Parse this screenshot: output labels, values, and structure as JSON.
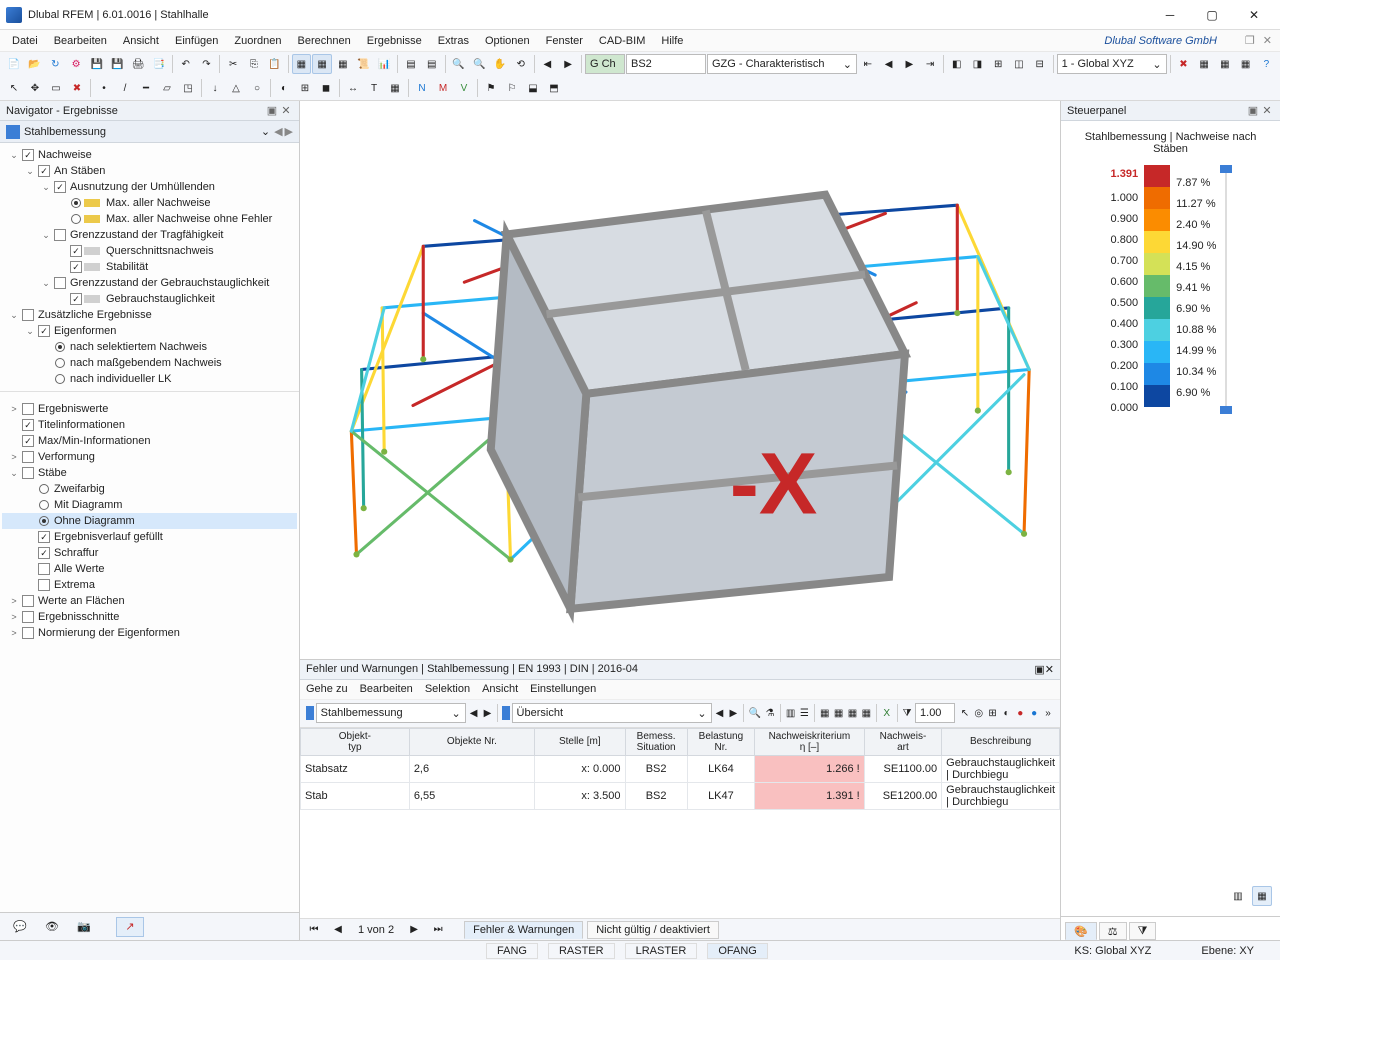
{
  "app": {
    "title": "Dlubal RFEM | 6.01.0016 | Stahlhalle",
    "vendor": "Dlubal Software GmbH"
  },
  "menu": [
    "Datei",
    "Bearbeiten",
    "Ansicht",
    "Einfügen",
    "Zuordnen",
    "Berechnen",
    "Ergebnisse",
    "Extras",
    "Optionen",
    "Fenster",
    "CAD-BIM",
    "Hilfe"
  ],
  "toolbar2": {
    "gch_btn": "G Ch",
    "field1": "BS2",
    "combo": "GZG - Charakteristisch",
    "coord_combo": "1 - Global XYZ"
  },
  "navigator": {
    "title": "Navigator - Ergebnisse",
    "section": "Stahlbemessung",
    "tree1": [
      {
        "lvl": 0,
        "tw": "⌄",
        "cb": true,
        "label": "Nachweise"
      },
      {
        "lvl": 1,
        "tw": "⌄",
        "cb": true,
        "label": "An Stäben"
      },
      {
        "lvl": 2,
        "tw": "⌄",
        "cb": true,
        "label": "Ausnutzung der Umhüllenden"
      },
      {
        "lvl": 3,
        "rb": true,
        "label": "Max. aller Nachweise",
        "sw": "#ecc94a"
      },
      {
        "lvl": 3,
        "rb": false,
        "label": "Max. aller Nachweise ohne Fehler",
        "sw": "#ecc94a"
      },
      {
        "lvl": 2,
        "tw": "⌄",
        "cb": false,
        "label": "Grenzzustand der Tragfähigkeit"
      },
      {
        "lvl": 3,
        "cb": true,
        "label": "Querschnittsnachweis",
        "sw": "#d0d0d0"
      },
      {
        "lvl": 3,
        "cb": true,
        "label": "Stabilität",
        "sw": "#d0d0d0"
      },
      {
        "lvl": 2,
        "tw": "⌄",
        "cb": false,
        "label": "Grenzzustand der Gebrauchstauglichkeit"
      },
      {
        "lvl": 3,
        "cb": true,
        "label": "Gebrauchstauglichkeit",
        "sw": "#d0d0d0"
      },
      {
        "lvl": 0,
        "tw": "⌄",
        "cb": false,
        "label": "Zusätzliche Ergebnisse"
      },
      {
        "lvl": 1,
        "tw": "⌄",
        "cb": true,
        "label": "Eigenformen"
      },
      {
        "lvl": 2,
        "rb": true,
        "label": "nach selektiertem Nachweis"
      },
      {
        "lvl": 2,
        "rb": false,
        "label": "nach maßgebendem Nachweis"
      },
      {
        "lvl": 2,
        "rb": false,
        "label": "nach individueller LK"
      }
    ],
    "tree2": [
      {
        "lvl": 0,
        "tw": ">",
        "cb": false,
        "label": "Ergebniswerte"
      },
      {
        "lvl": 0,
        "cb": true,
        "label": "Titelinformationen"
      },
      {
        "lvl": 0,
        "cb": true,
        "label": "Max/Min-Informationen"
      },
      {
        "lvl": 0,
        "tw": ">",
        "cb": false,
        "label": "Verformung"
      },
      {
        "lvl": 0,
        "tw": "⌄",
        "cb": false,
        "label": "Stäbe"
      },
      {
        "lvl": 1,
        "rb": false,
        "label": "Zweifarbig"
      },
      {
        "lvl": 1,
        "rb": false,
        "label": "Mit Diagramm"
      },
      {
        "lvl": 1,
        "rb": true,
        "label": "Ohne Diagramm",
        "sel": true
      },
      {
        "lvl": 1,
        "cb": true,
        "label": "Ergebnisverlauf gefüllt"
      },
      {
        "lvl": 1,
        "cb": true,
        "label": "Schraffur"
      },
      {
        "lvl": 1,
        "cb": false,
        "label": "Alle Werte"
      },
      {
        "lvl": 1,
        "cb": false,
        "label": "Extrema"
      },
      {
        "lvl": 0,
        "tw": ">",
        "cb": false,
        "label": "Werte an Flächen"
      },
      {
        "lvl": 0,
        "tw": ">",
        "cb": false,
        "label": "Ergebnisschnitte"
      },
      {
        "lvl": 0,
        "tw": ">",
        "cb": false,
        "label": "Normierung der Eigenformen"
      }
    ]
  },
  "steuerpanel": {
    "title": "Steuerpanel",
    "subtitle": "Stahlbemessung | Nachweise nach Stäben",
    "max": "1.391",
    "scale": [
      "1.000",
      "0.900",
      "0.800",
      "0.700",
      "0.600",
      "0.500",
      "0.400",
      "0.300",
      "0.200",
      "0.100",
      "0.000"
    ],
    "colors": [
      "#c62828",
      "#ef6c00",
      "#fb8c00",
      "#fdd835",
      "#d4e157",
      "#66bb6a",
      "#26a69a",
      "#4dd0e1",
      "#29b6f6",
      "#1e88e5",
      "#0d47a1"
    ],
    "pct": [
      "7.87 %",
      "11.27 %",
      "2.40 %",
      "14.90 %",
      "4.15 %",
      "9.41 %",
      "6.90 %",
      "10.88 %",
      "14.99 %",
      "10.34 %",
      "6.90 %"
    ]
  },
  "bottom": {
    "title": "Fehler und Warnungen | Stahlbemessung | EN 1993 | DIN | 2016-04",
    "menu": [
      "Gehe zu",
      "Bearbeiten",
      "Selektion",
      "Ansicht",
      "Einstellungen"
    ],
    "combo1": "Stahlbemessung",
    "combo2": "Übersicht",
    "headers": [
      "Objekt-\ntyp",
      "Objekte Nr.",
      "Stelle [m]",
      "Bemess.\nSituation",
      "Belastung\nNr.",
      "Nachweiskriterium\nη [–]",
      "Nachweis-\nart",
      "Beschreibung"
    ],
    "rows": [
      {
        "typ": "Stabsatz",
        "nr": "2,6",
        "stelle": "x: 0.000",
        "sit": "BS2",
        "bel": "LK64",
        "krit": "1.266",
        "warn": "!",
        "art": "SE1100.00",
        "desc": "Gebrauchstauglichkeit | Durchbiegu"
      },
      {
        "typ": "Stab",
        "nr": "6,55",
        "stelle": "x: 3.500",
        "sit": "BS2",
        "bel": "LK47",
        "krit": "1.391",
        "warn": "!",
        "art": "SE1200.00",
        "desc": "Gebrauchstauglichkeit | Durchbiegu"
      }
    ],
    "pager": "1 von 2",
    "tabs": [
      "Fehler & Warnungen",
      "Nicht gültig / deaktiviert"
    ]
  },
  "status": {
    "snaps": [
      "FANG",
      "RASTER",
      "LRASTER",
      "OFANG"
    ],
    "ks": "KS: Global XYZ",
    "ebene": "Ebene: XY"
  },
  "navcube_label": "-X"
}
